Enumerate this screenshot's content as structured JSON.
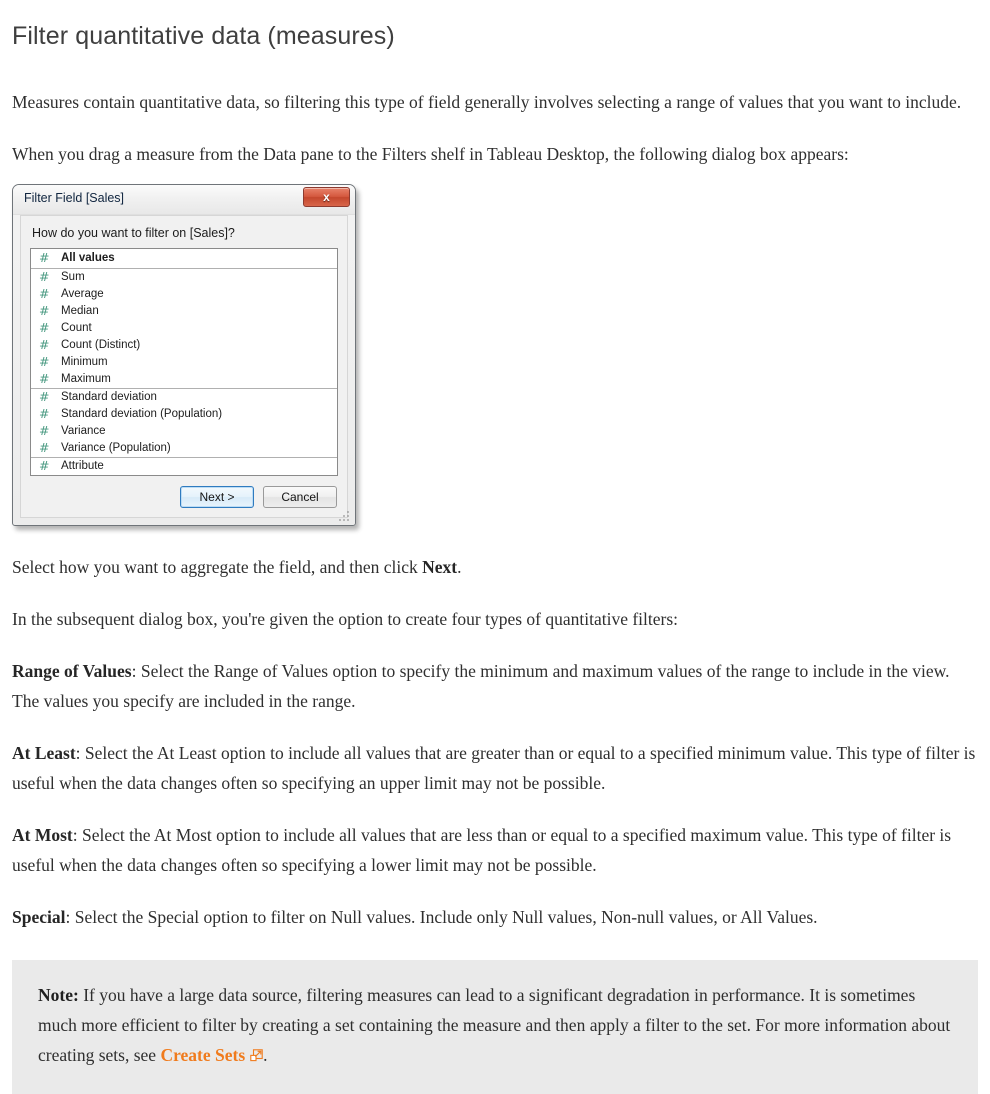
{
  "page": {
    "title": "Filter quantitative data (measures)",
    "paragraphs": {
      "intro": "Measures contain quantitative data, so filtering this type of field generally involves selecting a range of values that you want to include.",
      "drag_measure": "When you drag a measure from the Data pane to the Filters shelf in Tableau Desktop, the following dialog box appears:",
      "select_aggregate_pre": "Select how you want to aggregate the field, and then click ",
      "select_aggregate_bold": "Next",
      "select_aggregate_post": ".",
      "subsequent_dialog": "In the subsequent dialog box, you're given the option to create four types of quantitative filters:"
    },
    "filter_types": [
      {
        "term": "Range of Values",
        "description": ": Select the Range of Values option to specify the minimum and maximum values of the range to include in the view. The values you specify are included in the range."
      },
      {
        "term": "At Least",
        "description": ": Select the At Least option to include all values that are greater than or equal to a specified minimum value. This type of filter is useful when the data changes often so specifying an upper limit may not be possible."
      },
      {
        "term": "At Most",
        "description": ": Select the At Most option to include all values that are less than or equal to a specified maximum value. This type of filter is useful when the data changes often so specifying a lower limit may not be possible."
      },
      {
        "term": "Special",
        "description": ": Select the Special option to filter on Null values. Include only Null values, Non-null values, or All Values."
      }
    ],
    "note": {
      "label": "Note:",
      "text_before_link": " If you have a large data source, filtering measures can lead to a significant degradation in performance. It is sometimes much more efficient to filter by creating a set containing the measure and then apply a filter to the set. For more information about creating sets, see ",
      "link_label": "Create Sets",
      "link_icon": "external-link-icon",
      "text_after_link": ".",
      "background_color": "#eaeaea",
      "link_color": "#f07b1d"
    }
  },
  "dialog": {
    "title": "Filter Field [Sales]",
    "close_label": "x",
    "close_icon": "close-icon",
    "prompt": "How do you want to filter on [Sales]?",
    "field_icon": "hash-icon",
    "field_icon_color": "#4a9a82",
    "groups": [
      {
        "rows": [
          {
            "label": "All values",
            "selected": true
          }
        ]
      },
      {
        "rows": [
          {
            "label": "Sum",
            "selected": false
          },
          {
            "label": "Average",
            "selected": false
          },
          {
            "label": "Median",
            "selected": false
          },
          {
            "label": "Count",
            "selected": false
          },
          {
            "label": "Count (Distinct)",
            "selected": false
          },
          {
            "label": "Minimum",
            "selected": false
          },
          {
            "label": "Maximum",
            "selected": false
          }
        ]
      },
      {
        "rows": [
          {
            "label": "Standard deviation",
            "selected": false
          },
          {
            "label": "Standard deviation (Population)",
            "selected": false
          },
          {
            "label": "Variance",
            "selected": false
          },
          {
            "label": "Variance (Population)",
            "selected": false
          }
        ]
      },
      {
        "rows": [
          {
            "label": "Attribute",
            "selected": false
          }
        ]
      }
    ],
    "buttons": {
      "next": "Next >",
      "cancel": "Cancel"
    }
  }
}
